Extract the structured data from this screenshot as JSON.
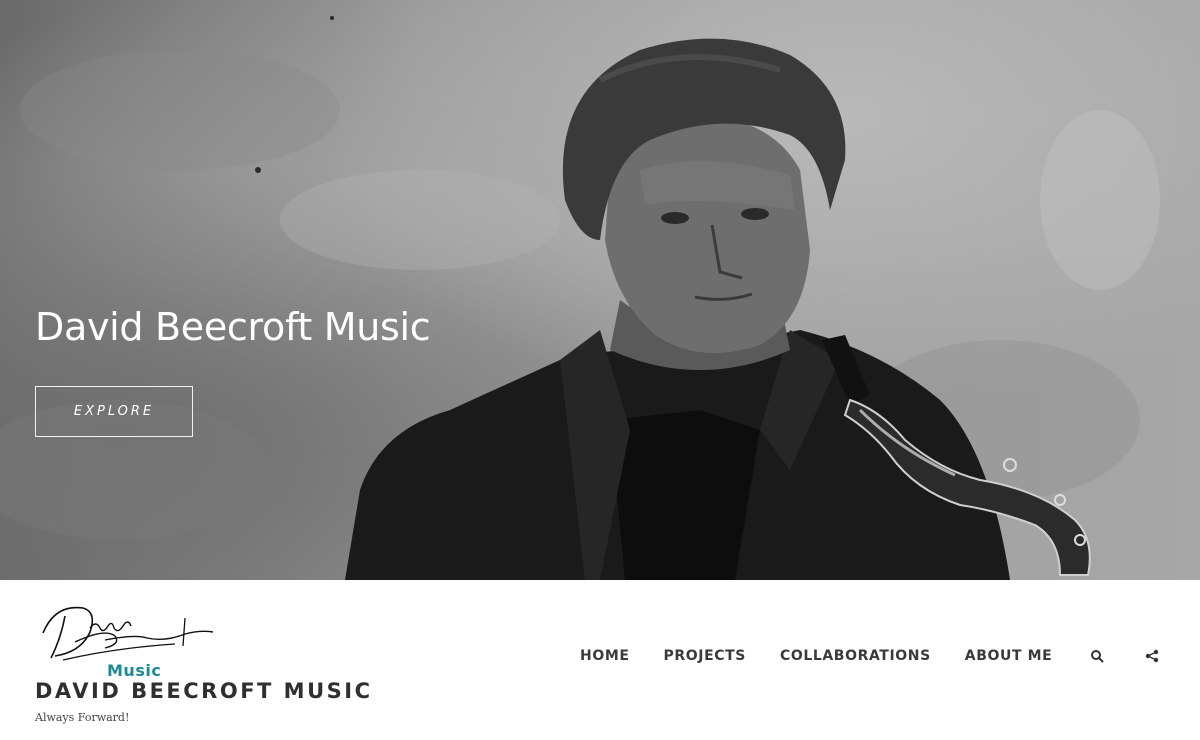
{
  "hero": {
    "title": "David Beecroft Music",
    "cta_label": "EXPLORE"
  },
  "header": {
    "logo_script": "David Beecroft",
    "logo_word": "Music",
    "site_name": "DAVID BEECROFT MUSIC",
    "tagline": "Always Forward!",
    "accent_color": "#1d8a96"
  },
  "nav": {
    "items": [
      "HOME",
      "PROJECTS",
      "COLLABORATIONS",
      "ABOUT ME"
    ],
    "icons": [
      "search-icon",
      "share-icon"
    ]
  }
}
